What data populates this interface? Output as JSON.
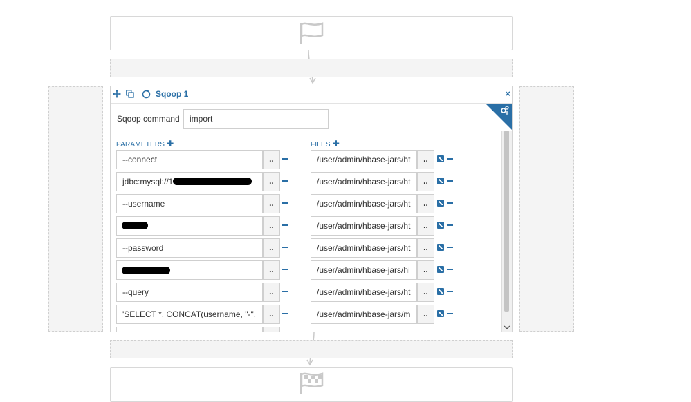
{
  "action": {
    "title": "Sqoop 1",
    "close_label": "×",
    "command_label": "Sqoop command",
    "command_value": "import"
  },
  "parameters": {
    "label": "PARAMETERS",
    "add_label": "✚",
    "browse_label": "..",
    "items": [
      "--connect",
      "jdbc:mysql://1",
      "--username",
      "",
      "--password",
      "",
      "--query",
      "'SELECT *, CONCAT(username, \"-\","
    ]
  },
  "files": {
    "label": "FILES",
    "add_label": "✚",
    "browse_label": "..",
    "items": [
      "/user/admin/hbase-jars/ht",
      "/user/admin/hbase-jars/ht",
      "/user/admin/hbase-jars/ht",
      "/user/admin/hbase-jars/ht",
      "/user/admin/hbase-jars/ht",
      "/user/admin/hbase-jars/hi",
      "/user/admin/hbase-jars/ht",
      "/user/admin/hbase-jars/m"
    ]
  }
}
